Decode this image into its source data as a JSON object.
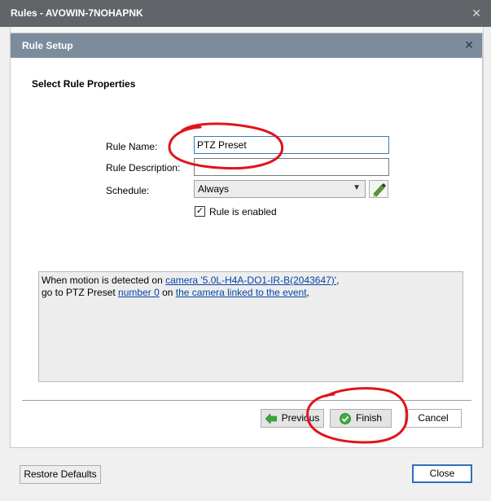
{
  "window": {
    "title": "Rules - AVOWIN-7NOHAPNK",
    "close_glyph": "✕"
  },
  "dialog": {
    "title": "Rule Setup",
    "close_glyph": "✕",
    "heading": "Select Rule Properties",
    "fields": {
      "rule_name_label": "Rule Name:",
      "rule_name_value": "PTZ Preset",
      "rule_description_label": "Rule Description:",
      "rule_description_value": "",
      "schedule_label": "Schedule:",
      "schedule_value": "Always",
      "enabled_label": "Rule is enabled",
      "enabled_checked": true
    },
    "summary": {
      "line1_prefix": "When motion is detected on ",
      "line1_link": "camera '5.0L-H4A-DO1-IR-B(2043647)'",
      "line1_suffix": ",",
      "line2_prefix": "go to PTZ Preset ",
      "line2_link1": "number 0",
      "line2_mid": " on ",
      "line2_link2": "the camera linked to the event",
      "line2_suffix": ","
    },
    "buttons": {
      "previous": "Previous",
      "finish": "Finish",
      "cancel": "Cancel"
    }
  },
  "footer": {
    "restore_defaults": "Restore Defaults",
    "close": "Close"
  },
  "colors": {
    "outer_titlebar": "#61656a",
    "dialog_titlebar": "#7d8c9d",
    "link": "#0645a8",
    "annotation_red": "#e0141c",
    "default_button_border": "#2f6fc0"
  }
}
